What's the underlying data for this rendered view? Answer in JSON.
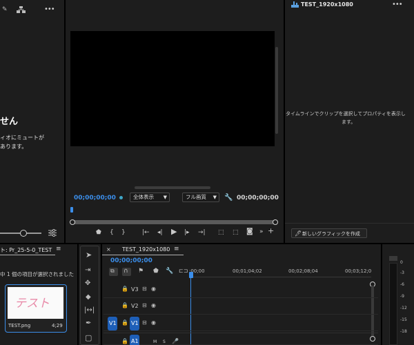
{
  "source_panel": {
    "no_clip_text": "せん",
    "mute_line1": "ィオにミュートが",
    "mute_line2": "あります。",
    "menu_label": "•••"
  },
  "program_monitor": {
    "timecode_left": "00;00;00;00",
    "timecode_right": "00;00;00;00",
    "zoom_value": "全体表示",
    "quality_value": "フル画質"
  },
  "properties_panel": {
    "title": "TEST_1920x1080",
    "empty_text_line1": "タイムラインでクリップを選択してプロパティを表示し",
    "empty_text_line2": "ます。",
    "new_graphic_button": "新しいグラフィックを作成",
    "menu_label": "•••"
  },
  "project_panel": {
    "title": "ト: Pr_25-5-0_TEST",
    "selection_status": "中 1 個の項目が選択されました",
    "clip": {
      "thumbnail_text": "テスト",
      "name": "TEST.png",
      "duration": "4;29"
    }
  },
  "timeline": {
    "tab_title": "TEST_1920x1080",
    "close_label": "×",
    "timecode": "00;00;00;00",
    "ruler": [
      ":00;00",
      "00;01;04;02",
      "00;02;08;04",
      "00;03;12;0"
    ],
    "tracks": [
      {
        "name": "V3",
        "source": ""
      },
      {
        "name": "V2",
        "source": ""
      },
      {
        "name": "V1",
        "source": "V1"
      },
      {
        "name": "A1",
        "source": ""
      }
    ],
    "audio_buttons": [
      "M",
      "S"
    ]
  },
  "audio_meter": {
    "labels": [
      "0",
      "-3",
      "-6",
      "-9",
      "-12",
      "-15",
      "-18"
    ]
  },
  "colors": {
    "accent_blue": "#3b8eea",
    "panel_bg": "#1d1d1d",
    "divider": "#000000"
  }
}
